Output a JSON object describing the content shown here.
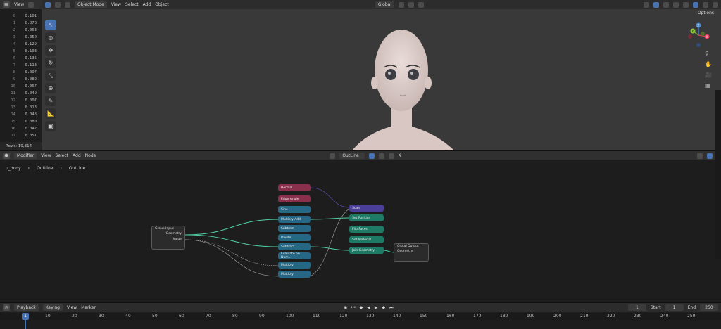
{
  "spreadsheet": {
    "menu_view": "View",
    "rows": [
      {
        "i": "0",
        "v": "0.101"
      },
      {
        "i": "1",
        "v": "0.078"
      },
      {
        "i": "2",
        "v": "0.063"
      },
      {
        "i": "3",
        "v": "0.050"
      },
      {
        "i": "4",
        "v": "0.129"
      },
      {
        "i": "5",
        "v": "0.103"
      },
      {
        "i": "6",
        "v": "0.136"
      },
      {
        "i": "7",
        "v": "0.113"
      },
      {
        "i": "8",
        "v": "0.097"
      },
      {
        "i": "9",
        "v": "0.089"
      },
      {
        "i": "10",
        "v": "0.067"
      },
      {
        "i": "11",
        "v": "0.049"
      },
      {
        "i": "12",
        "v": "0.007"
      },
      {
        "i": "13",
        "v": "0.013"
      },
      {
        "i": "14",
        "v": "0.048"
      },
      {
        "i": "15",
        "v": "0.080"
      },
      {
        "i": "16",
        "v": "0.042"
      },
      {
        "i": "17",
        "v": "0.051"
      }
    ],
    "footer": "Rows: 19,314"
  },
  "viewport": {
    "mode": "Object Mode",
    "menu": [
      "View",
      "Select",
      "Add",
      "Object"
    ],
    "transform": "Global",
    "options": "Options",
    "gizmo_axes": [
      "Z",
      "Y",
      "X"
    ]
  },
  "nodes": {
    "editor_type": "Modifier",
    "menu": [
      "View",
      "Select",
      "Add",
      "Node"
    ],
    "tree_name": "OutLine",
    "breadcrumb": [
      "u_body",
      "OutLine",
      "OutLine"
    ],
    "group_input": {
      "title": "Group Input",
      "outputs": [
        "Geometry",
        "Value"
      ]
    },
    "group_output": {
      "title": "Group Output",
      "inputs": [
        "Geometry"
      ]
    },
    "left_column": [
      "Normal",
      "Edge Angle",
      "Sine",
      "Multiply Add",
      "Subtract",
      "Divide",
      "Subtract",
      "Evaluate on Dom...",
      "Multiply",
      "Multiply"
    ],
    "right_column": [
      "Scale",
      "Set Position",
      "Flip Faces",
      "Set Material",
      "Join Geometry"
    ]
  },
  "timeline": {
    "menu": [
      "Playback",
      "Keying",
      "View",
      "Marker"
    ],
    "current_frame": "1",
    "start_label": "Start",
    "start": "1",
    "end_label": "End",
    "end": "250",
    "ruler": [
      "10",
      "20",
      "30",
      "40",
      "50",
      "60",
      "70",
      "80",
      "90",
      "100",
      "110",
      "120",
      "130",
      "140",
      "150",
      "160",
      "170",
      "180",
      "190",
      "200",
      "210",
      "220",
      "230",
      "240",
      "250"
    ]
  },
  "colors": {
    "accent": "#4772b3",
    "node_red": "#8a2f4c",
    "node_blue": "#266785",
    "node_purple": "#4b3e98",
    "node_green": "#1d7a64",
    "link_geometry": "#4fd1a5"
  }
}
